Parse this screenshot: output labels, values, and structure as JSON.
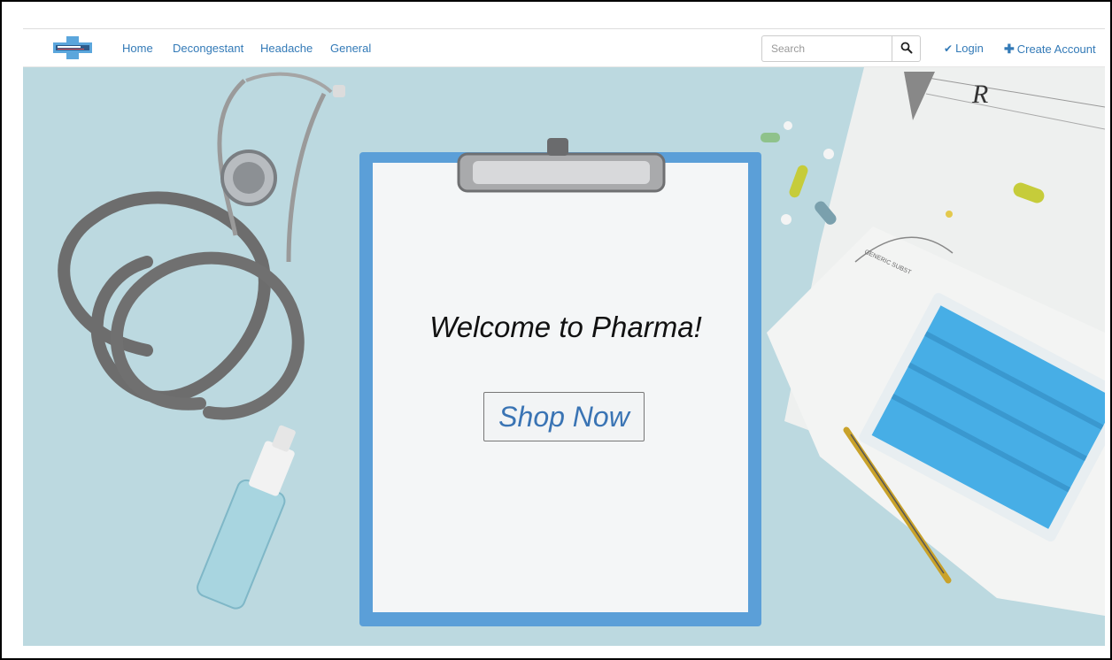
{
  "nav": {
    "links": [
      {
        "label": "Home"
      },
      {
        "label": "Decongestant"
      },
      {
        "label": "Headache"
      },
      {
        "label": "General"
      }
    ],
    "search": {
      "placeholder": "Search",
      "value": ""
    },
    "login": {
      "label": "Login",
      "icon": "checkmark-icon"
    },
    "create_account": {
      "label": "Create Account",
      "icon": "plus-icon"
    }
  },
  "hero": {
    "heading": "Welcome to Pharma!",
    "cta": "Shop Now",
    "prescription_mark": "R",
    "paper_text": "GENERIC SUBST"
  },
  "colors": {
    "link": "#337ab7",
    "hero_bg": "#bcd9e0",
    "clipboard": "#5b9fd8",
    "mask": "#47aee6"
  }
}
